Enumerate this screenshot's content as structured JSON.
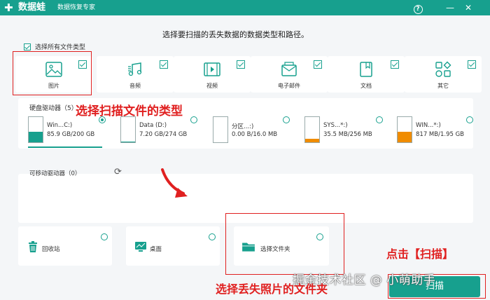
{
  "app": {
    "logo_mark": "✚",
    "brand": "数据蛙",
    "subtitle": "数据恢复专家",
    "help_label": "?",
    "minimize_label": "—",
    "close_label": "✕"
  },
  "instruction": "选择要扫描的丢失数据的数据类型和路径。",
  "select_all": {
    "label": "选择所有文件类型",
    "checked": true
  },
  "file_types": [
    {
      "label": "图片",
      "icon": "image-icon",
      "checked": true
    },
    {
      "label": "音频",
      "icon": "music-icon",
      "checked": true
    },
    {
      "label": "视频",
      "icon": "video-icon",
      "checked": true
    },
    {
      "label": "电子邮件",
      "icon": "email-icon",
      "checked": true
    },
    {
      "label": "文档",
      "icon": "document-icon",
      "checked": true
    },
    {
      "label": "其它",
      "icon": "other-icon",
      "checked": true
    }
  ],
  "hard_drives": {
    "title": "硬盘驱动器（5）",
    "drives": [
      {
        "name": "Win...C:)",
        "size": "85.9 GB/200 GB",
        "fill": 0.43,
        "color": "#17a08e",
        "selected": true
      },
      {
        "name": "Data (D:)",
        "size": "7.20 GB/274 GB",
        "fill": 0.03,
        "color": "#17a08e",
        "selected": false
      },
      {
        "name": "分区...:)",
        "size": "0.00  B/16.0 MB",
        "fill": 0.0,
        "color": "#17a08e",
        "selected": false
      },
      {
        "name": "SYS...*:)",
        "size": "35.5 MB/256 MB",
        "fill": 0.14,
        "color": "#f08c00",
        "selected": false
      },
      {
        "name": "WIN...*:)",
        "size": "817 MB/1.95 GB",
        "fill": 0.42,
        "color": "#f08c00",
        "selected": false
      }
    ]
  },
  "removable": {
    "title": "可移动驱动器（0）",
    "refresh_icon": "refresh-icon"
  },
  "locations": [
    {
      "label": "回收站",
      "icon": "trash-icon"
    },
    {
      "label": "桌面",
      "icon": "desktop-icon"
    },
    {
      "label": "选择文件夹",
      "icon": "folder-icon"
    }
  ],
  "scan_button": {
    "label": "扫描"
  },
  "annotations": {
    "select_type": "选择扫描文件的类型",
    "click_scan": "点击【扫描】",
    "select_folder": "选择丢失照片的文件夹"
  },
  "watermark": "掘金技术社区 @ 小萌助手",
  "colors": {
    "accent": "#17a08e",
    "annotation": "#e02020",
    "warning": "#f08c00"
  }
}
